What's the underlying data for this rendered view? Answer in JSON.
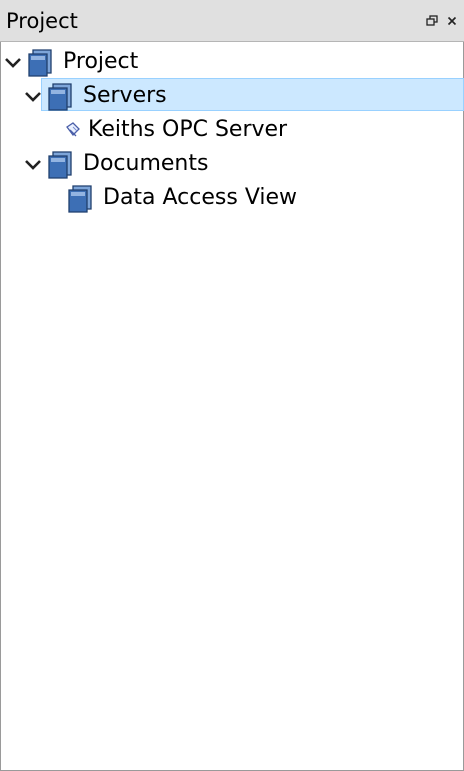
{
  "panel": {
    "title": "Project",
    "float_icon": "restore-icon",
    "close_icon": "close-icon"
  },
  "tree": {
    "root": {
      "label": "Project",
      "icon": "folder-icon",
      "expanded": true
    },
    "servers": {
      "label": "Servers",
      "icon": "folder-icon",
      "expanded": true,
      "selected": true
    },
    "server_item": {
      "label": "Keiths OPC Server",
      "icon": "opc-server-icon"
    },
    "documents": {
      "label": "Documents",
      "icon": "folder-icon",
      "expanded": true
    },
    "document_item": {
      "label": "Data Access View",
      "icon": "folder-icon"
    }
  },
  "colors": {
    "titlebar_bg": "#e0e0e0",
    "selection_bg": "#cce8ff",
    "selection_border": "#99d1ff",
    "folder_blue": "#3d6fb5"
  }
}
